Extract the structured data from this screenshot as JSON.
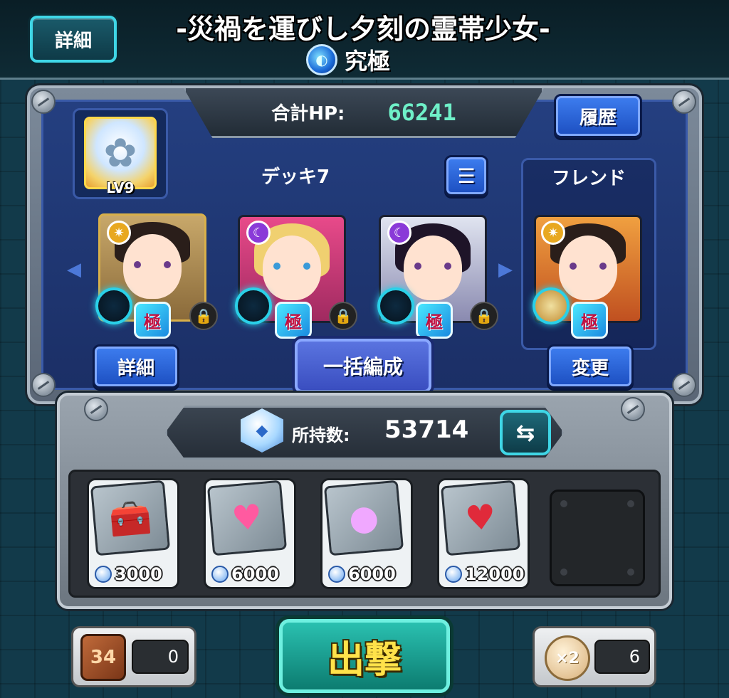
{
  "header": {
    "detail_label": "詳細",
    "quest_title": "-災禍を運びし夕刻の霊帯少女-",
    "difficulty": "究極",
    "difficulty_icon": "water-element-icon"
  },
  "deck": {
    "total_hp_label": "合計HP:",
    "total_hp_value": "66241",
    "history_label": "履歴",
    "deck_name": "デッキ7",
    "friend_label": "フレンド",
    "leader_level": "LV9",
    "detail_label": "詳細",
    "bulk_edit_label": "一括編成",
    "change_label": "変更",
    "badge_text": "極",
    "members": [
      {
        "slot": "leader",
        "element": "light",
        "hair": "#2a1e1a"
      },
      {
        "slot": "member-2",
        "element": "dark",
        "hair": "#f0d070"
      },
      {
        "slot": "member-3",
        "element": "dark",
        "hair": "#1e1428"
      },
      {
        "slot": "friend",
        "element": "light",
        "hair": "#2a1e1a"
      }
    ]
  },
  "inventory": {
    "owned_label": "所持数:",
    "owned_value": "53714",
    "items": [
      {
        "name": "treasure-chest-icon",
        "cost": "3000"
      },
      {
        "name": "heart-plus-icon",
        "cost": "6000"
      },
      {
        "name": "glowing-orb-icon",
        "cost": "6000"
      },
      {
        "name": "strawberry-heart-icon",
        "cost": "12000"
      }
    ]
  },
  "footer": {
    "dice_count": "0",
    "dice_face": "34",
    "sortie_label": "出撃",
    "coin_label": "×2",
    "coin_count": "6"
  },
  "colors": {
    "accent_cyan": "#3fd6e6",
    "hp_value": "#6ff0c8",
    "button_blue": "#2c64d8",
    "sortie_text": "#ffe24a"
  }
}
